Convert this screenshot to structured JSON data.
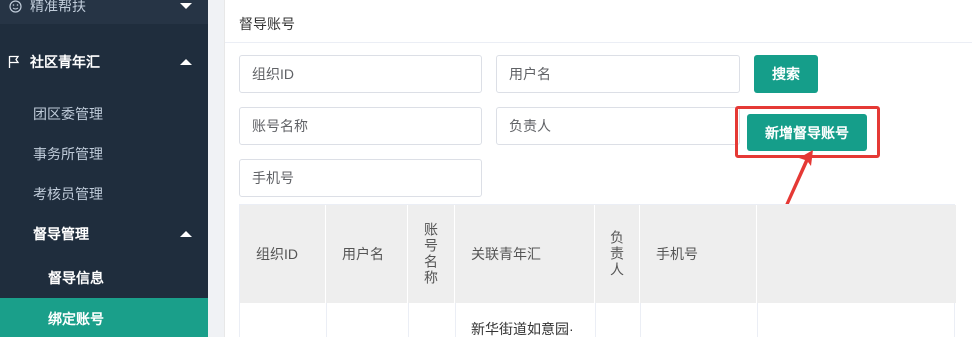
{
  "sidebar": {
    "top_item": "精准帮扶",
    "group": "社区青年汇",
    "items": [
      "团区委管理",
      "事务所管理",
      "考核员管理"
    ],
    "sub_group": "督导管理",
    "sub_items": [
      "督导信息",
      "绑定账号"
    ]
  },
  "card": {
    "title": "督导账号"
  },
  "filters": {
    "org_id": "组织ID",
    "username": "用户名",
    "account_name": "账号名称",
    "owner": "负责人",
    "phone": "手机号"
  },
  "buttons": {
    "search": "搜索",
    "add": "新增督导账号"
  },
  "table": {
    "headers": [
      "组织ID",
      "用户名",
      "账号名称",
      "关联青年汇",
      "负责人",
      "手机号",
      ""
    ],
    "first_row_partial": "新华街道如意园·"
  },
  "colors": {
    "accent": "#159e8a",
    "sidebar_bg": "#1f2d3d",
    "highlight": "#e53935"
  }
}
